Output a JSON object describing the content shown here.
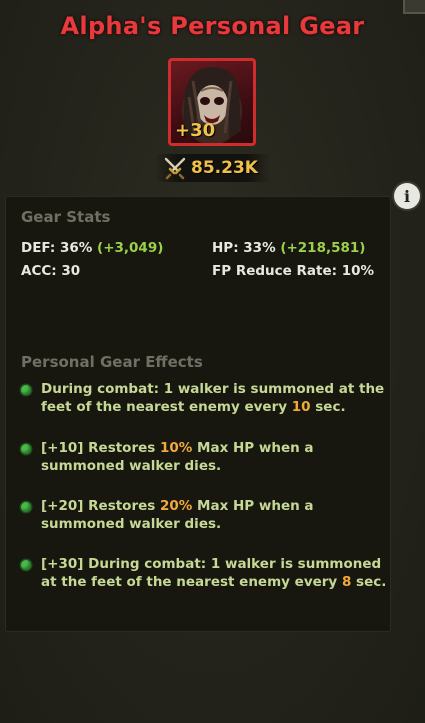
{
  "header": {
    "title": "Alpha's Personal Gear"
  },
  "gear": {
    "level": "+30",
    "power": "85.23K"
  },
  "icons": {
    "info": "i"
  },
  "gear_stats": {
    "title": "Gear Stats",
    "def_label": "DEF: 36%",
    "def_bonus": "(+3,049)",
    "hp_label": "HP: 33%",
    "hp_bonus": "(+218,581)",
    "acc": "ACC: 30",
    "fp": "FP Reduce Rate: 10%"
  },
  "effects": {
    "title": "Personal Gear Effects",
    "e1": {
      "pre": "During combat: 1 walker is summoned at the feet of the nearest enemy every ",
      "num": "10",
      "post": " sec."
    },
    "e2": {
      "pre": "[+10] Restores ",
      "num": "10%",
      "post": " Max HP when a summoned walker dies."
    },
    "e3": {
      "pre": "[+20] Restores ",
      "num": "20%",
      "post": " Max HP when a summoned walker dies."
    },
    "e4": {
      "pre": "[+30] During combat: 1 walker is summoned at the feet of the nearest enemy every ",
      "num": "8",
      "post": " sec."
    }
  },
  "colors": {
    "title": "#e8393d",
    "bonus": "#9bd04c",
    "highlight": "#f0a93a",
    "effect_text": "#c6d895"
  }
}
